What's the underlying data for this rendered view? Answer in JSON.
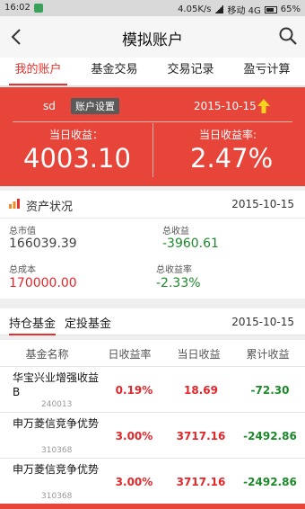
{
  "status_bar": {
    "time": "16:02",
    "speed": "4.05K/s",
    "carrier": "移动 4G",
    "battery": "65%"
  },
  "header": {
    "title": "模拟账户",
    "back_icon": "chevron-left-icon",
    "search_icon": "search-icon"
  },
  "tabs": [
    {
      "label": "我的账户",
      "active": true
    },
    {
      "label": "基金交易",
      "active": false
    },
    {
      "label": "交易记录",
      "active": false
    },
    {
      "label": "盈亏计算",
      "active": false
    }
  ],
  "account": {
    "username": "sd",
    "settings_label": "账户设置",
    "date": "2015-10-15",
    "day_profit_label": "当日收益：",
    "day_profit_value": "4003.10",
    "day_rate_label": "当日收益率:",
    "day_rate_value": "2.47%"
  },
  "assets": {
    "title": "资产状况",
    "date": "2015-10-15",
    "total_value_label": "总市值",
    "total_value": "166039.39",
    "total_profit_label": "总收益",
    "total_profit": "-3960.61",
    "total_cost_label": "总成本",
    "total_cost": "170000.00",
    "total_rate_label": "总收益率",
    "total_rate": "-2.33%"
  },
  "holdings": {
    "tabs": [
      {
        "label": "持仓基金",
        "active": true
      },
      {
        "label": "定投基金",
        "active": false
      }
    ],
    "date": "2015-10-15",
    "columns": [
      "基金名称",
      "日收益率",
      "当日收益",
      "累计收益"
    ],
    "rows": [
      {
        "name": "华宝兴业增强收益B",
        "code": "240013",
        "day_rate": "0.19%",
        "day_profit": "18.69",
        "total_profit": "-72.30"
      },
      {
        "name": "申万菱信竞争优势",
        "code": "310368",
        "day_rate": "3.00%",
        "day_profit": "3717.16",
        "total_profit": "-2492.86"
      },
      {
        "name": "申万菱信竞争优势",
        "code": "310368",
        "day_rate": "3.00%",
        "day_profit": "3717.16",
        "total_profit": "-2492.86"
      }
    ]
  },
  "colors": {
    "accent_red": "#e7443a",
    "positive_red": "#e4262a",
    "negative_green": "#1c8a2a"
  }
}
